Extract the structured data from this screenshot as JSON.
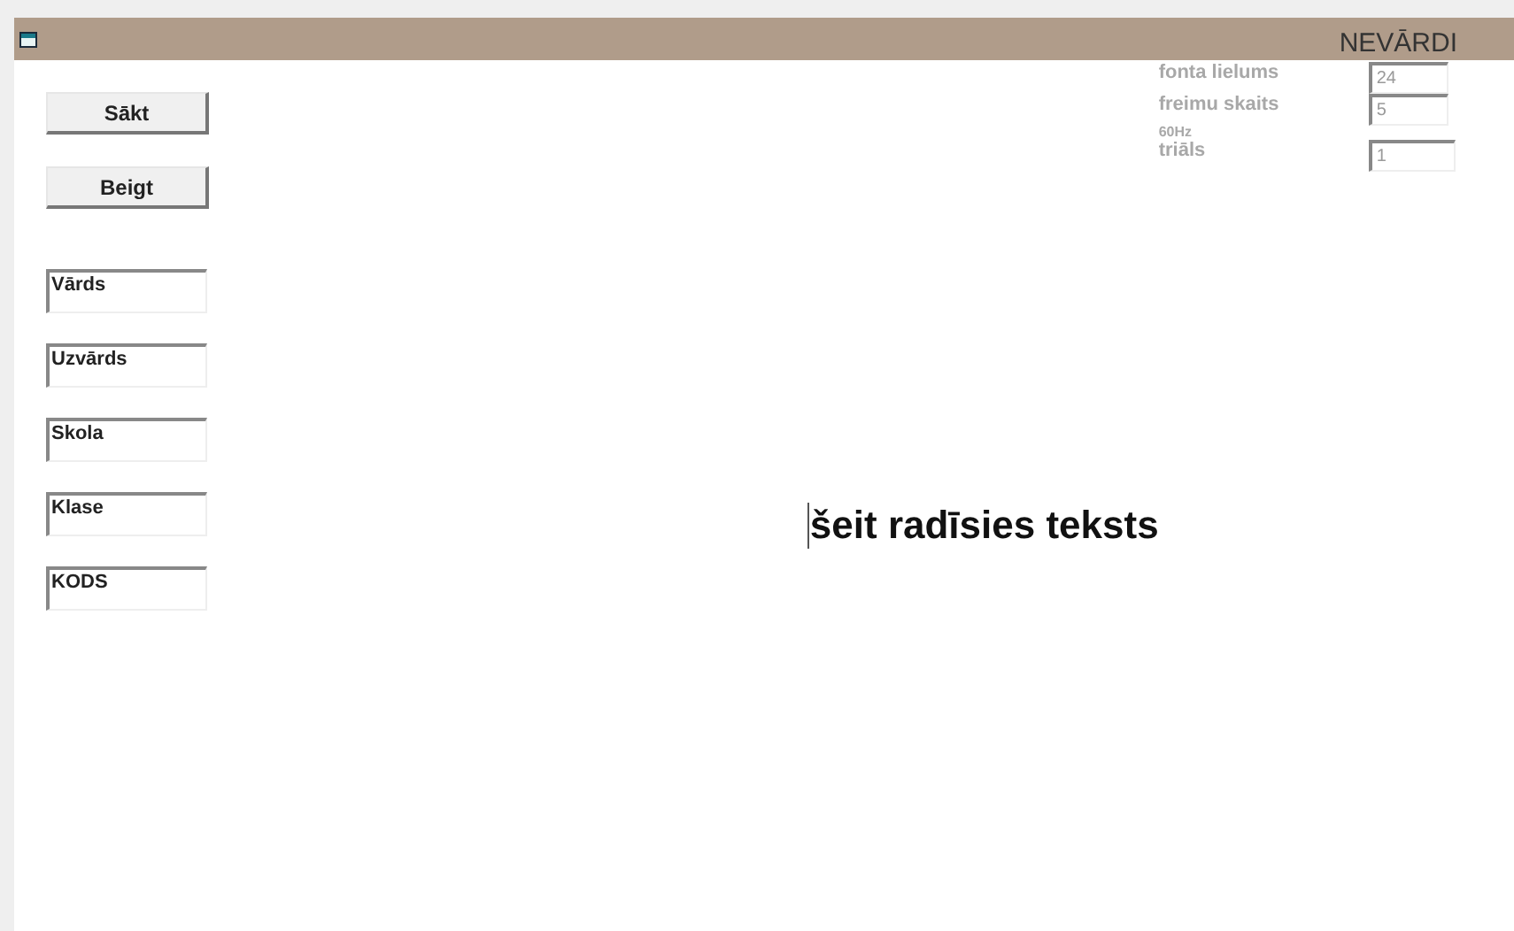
{
  "window": {
    "title": "NEVĀRDI"
  },
  "buttons": [
    "Sākt",
    "Beigt"
  ],
  "fields": [
    {
      "value": "Vārds",
      "disabled": false
    },
    {
      "value": "Uzvārds",
      "disabled": false
    },
    {
      "value": "Skola",
      "disabled": false
    },
    {
      "value": "Klase",
      "disabled": false
    },
    {
      "value": "KODS",
      "disabled": false
    }
  ],
  "settings": [
    {
      "label": "fonta lielums",
      "value": "24",
      "disabled": true
    },
    {
      "label": "freimu skaits",
      "value": "5",
      "disabled": true
    },
    {
      "label": "60Hz",
      "disabled": true
    },
    {
      "label": "triāls",
      "value": "1",
      "disabled": true
    }
  ],
  "display_text": "šeit radīsies teksts"
}
